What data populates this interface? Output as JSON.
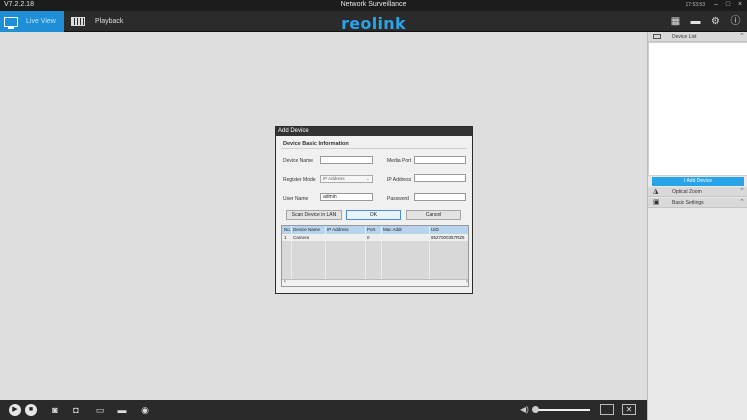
{
  "window": {
    "version": "V7.2.2.18",
    "title": "Network Surveillance",
    "clock": "17:53:53"
  },
  "nav": {
    "tabs": [
      {
        "label": "Live View",
        "active": true
      },
      {
        "label": "Playback",
        "active": false
      }
    ],
    "logo": "reolink"
  },
  "right_panel": {
    "device_list_label": "Device List",
    "add_device_label": "Add Device",
    "optical_zoom_label": "Optical Zoom",
    "basic_settings_label": "Basic Settings"
  },
  "dialog": {
    "title": "Add Device",
    "section_title": "Device Basic Information",
    "fields": {
      "device_name_label": "Device Name",
      "device_name_value": "",
      "media_port_label": "Media Port",
      "media_port_value": "",
      "register_mode_label": "Register Mode",
      "register_mode_value": "IP Address",
      "ip_address_label": "IP Address",
      "ip_address_value": "",
      "user_name_label": "User Name",
      "user_name_value": "admin",
      "password_label": "Password",
      "password_value": ""
    },
    "buttons": {
      "scan": "Scan Device in LAN",
      "ok": "OK",
      "cancel": "Cancel"
    },
    "table": {
      "columns": [
        "No.",
        "Device Name",
        "IP Address",
        "Port",
        "Mac Addr",
        "UID"
      ],
      "rows": [
        {
          "no": "1",
          "device_name": "Camera",
          "ip_address": "",
          "port": "0",
          "mac_addr": "",
          "uid": "9527000357RZ6"
        }
      ]
    }
  },
  "colors": {
    "accent": "#2aa4e8",
    "titlebar": "#1c1c1c",
    "navbar": "#2b2b2b"
  }
}
